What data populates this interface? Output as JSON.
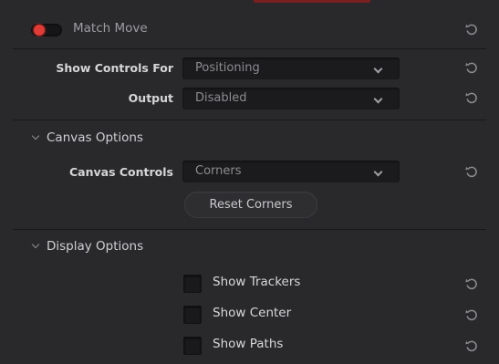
{
  "header": {
    "title": "Match Move",
    "toggle_on": true,
    "accent_color": "#e23a34"
  },
  "controls": {
    "show_controls_for": {
      "label": "Show Controls For",
      "value": "Positioning"
    },
    "output": {
      "label": "Output",
      "value": "Disabled"
    }
  },
  "canvas_options": {
    "title": "Canvas Options",
    "canvas_controls": {
      "label": "Canvas Controls",
      "value": "Corners"
    },
    "reset_corners_label": "Reset Corners"
  },
  "display_options": {
    "title": "Display Options",
    "checkboxes": [
      {
        "label": "Show Trackers",
        "checked": false
      },
      {
        "label": "Show Center",
        "checked": false
      },
      {
        "label": "Show Paths",
        "checked": false
      }
    ]
  },
  "icons": {
    "reset": "reset-icon",
    "chevron": "chevron-down-icon",
    "section_chevron": "chevron-down-icon"
  }
}
